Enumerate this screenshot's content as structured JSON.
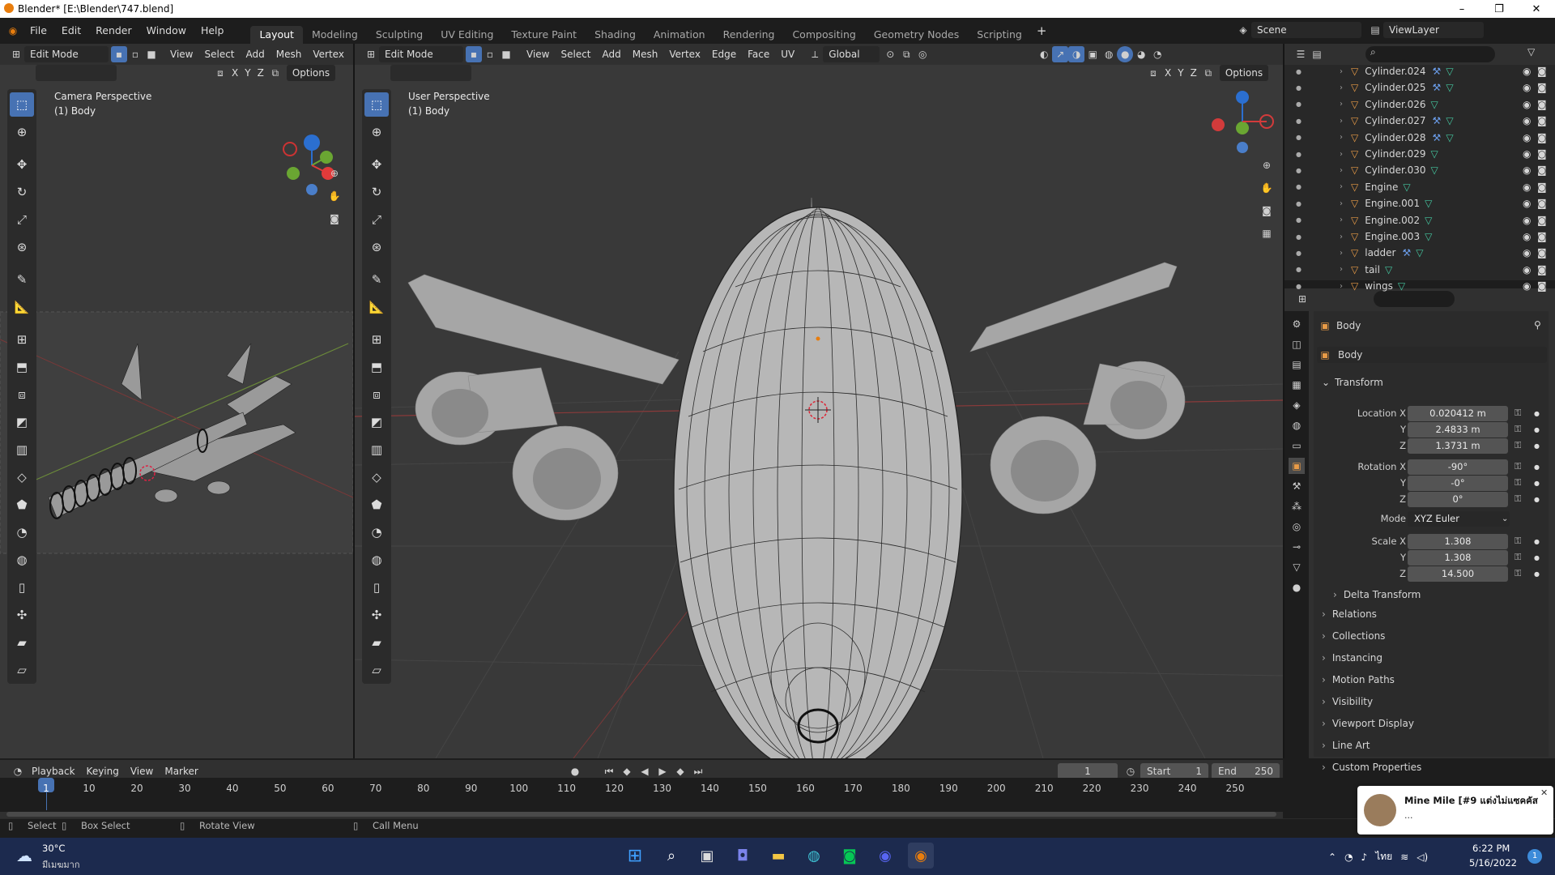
{
  "window": {
    "title": "Blender* [E:\\Blender\\747.blend]",
    "minimize": "–",
    "maximize": "❐",
    "close": "✕"
  },
  "menus": [
    "File",
    "Edit",
    "Render",
    "Window",
    "Help"
  ],
  "workspaces": [
    "Layout",
    "Modeling",
    "Sculpting",
    "UV Editing",
    "Texture Paint",
    "Shading",
    "Animation",
    "Rendering",
    "Compositing",
    "Geometry Nodes",
    "Scripting"
  ],
  "add_workspace": "+",
  "scene": {
    "name": "Scene",
    "view_layer": "ViewLayer"
  },
  "left_viewport": {
    "mode": "Edit Mode",
    "menus": [
      "View",
      "Select",
      "Add",
      "Mesh",
      "Vertex"
    ],
    "options": "Options",
    "axes": [
      "X",
      "Y",
      "Z"
    ],
    "label1": "Camera Perspective",
    "label2": "(1) Body"
  },
  "main_viewport": {
    "mode": "Edit Mode",
    "menus": [
      "View",
      "Select",
      "Add",
      "Mesh",
      "Vertex",
      "Edge",
      "Face",
      "UV"
    ],
    "orientation": "Global",
    "options": "Options",
    "axes": [
      "X",
      "Y",
      "Z"
    ],
    "label1": "User Perspective",
    "label2": "(1) Body"
  },
  "outliner": {
    "items": [
      {
        "name": "Cylinder.024",
        "mod": true
      },
      {
        "name": "Cylinder.025",
        "mod": true
      },
      {
        "name": "Cylinder.026",
        "mod": false
      },
      {
        "name": "Cylinder.027",
        "mod": true
      },
      {
        "name": "Cylinder.028",
        "mod": true
      },
      {
        "name": "Cylinder.029",
        "mod": false
      },
      {
        "name": "Cylinder.030",
        "mod": false
      },
      {
        "name": "Engine",
        "mod": false
      },
      {
        "name": "Engine.001",
        "mod": false
      },
      {
        "name": "Engine.002",
        "mod": false
      },
      {
        "name": "Engine.003",
        "mod": false
      },
      {
        "name": "ladder",
        "mod": true
      },
      {
        "name": "tail",
        "mod": false
      },
      {
        "name": "wings",
        "mod": false
      }
    ]
  },
  "properties": {
    "object_name": "Body",
    "datablock": "Body",
    "transform_title": "Transform",
    "location_label": "Location X",
    "location": {
      "x": "0.020412 m",
      "y": "2.4833 m",
      "z": "1.3731 m"
    },
    "rotation_label": "Rotation X",
    "rotation": {
      "x": "-90°",
      "y": "-0°",
      "z": "0°"
    },
    "mode_label": "Mode",
    "mode": "XYZ Euler",
    "scale_label": "Scale X",
    "scale": {
      "x": "1.308",
      "y": "1.308",
      "z": "14.500"
    },
    "y_label": "Y",
    "z_label": "Z",
    "sections": [
      "Delta Transform",
      "Relations",
      "Collections",
      "Instancing",
      "Motion Paths",
      "Visibility",
      "Viewport Display",
      "Line Art",
      "Custom Properties"
    ]
  },
  "timeline": {
    "menus": [
      "Playback",
      "Keying",
      "View",
      "Marker"
    ],
    "current_frame": "1",
    "start_label": "Start",
    "start": "1",
    "end_label": "End",
    "end": "250",
    "ticks": [
      "1",
      "10",
      "20",
      "30",
      "40",
      "50",
      "60",
      "70",
      "80",
      "90",
      "100",
      "110",
      "120",
      "130",
      "140",
      "150",
      "160",
      "170",
      "180",
      "190",
      "200",
      "210",
      "220",
      "230",
      "240",
      "250"
    ]
  },
  "statusbar": {
    "items": [
      "Select",
      "Box Select",
      "Rotate View",
      "Call Menu"
    ]
  },
  "notification": {
    "title": "Mine Mile [#9 แต่งไม่แซคคัส ...",
    "sub": "..."
  },
  "taskbar": {
    "weather_temp": "30°C",
    "weather_desc": "มีเมฆมาก",
    "lang": "ไทย",
    "time": "6:22 PM",
    "date": "5/16/2022",
    "badge": "1"
  }
}
